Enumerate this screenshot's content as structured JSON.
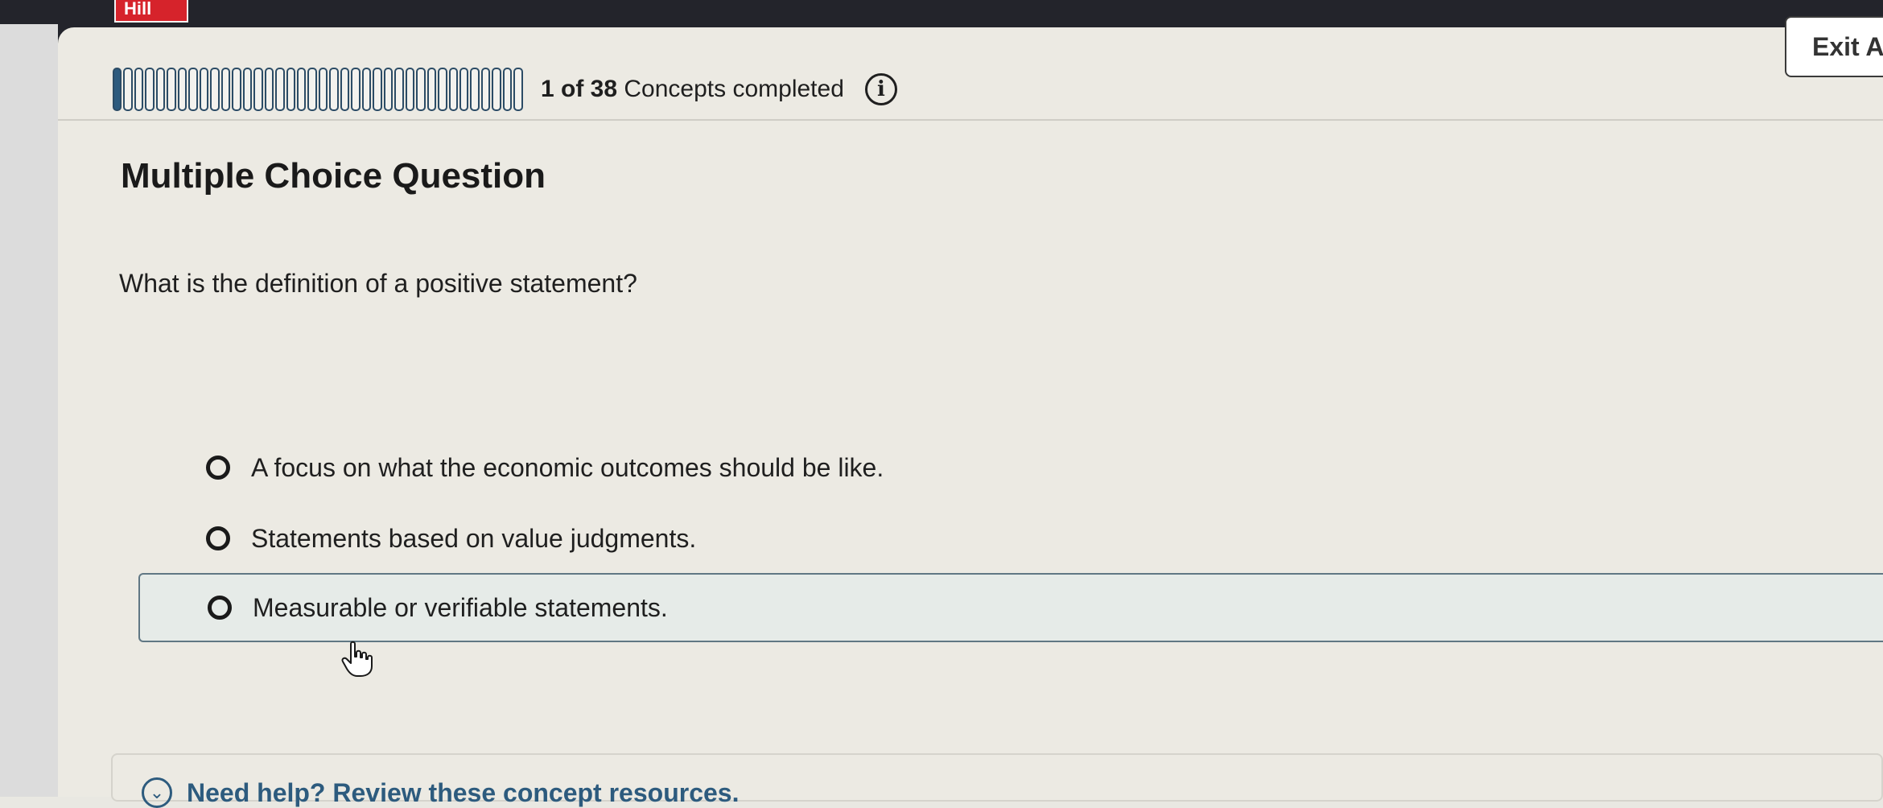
{
  "header": {
    "logo_text": "Hill",
    "exit_label": "Exit As"
  },
  "progress": {
    "completed": 1,
    "total": 38,
    "count_text": "1 of 38",
    "suffix_text": "Concepts completed",
    "info_icon_glyph": "i"
  },
  "question": {
    "type_label": "Multiple Choice Question",
    "prompt": "What is the definition of a positive statement?",
    "options": [
      {
        "label": "A focus on what the economic outcomes should be like."
      },
      {
        "label": "Statements based on value judgments."
      },
      {
        "label": "Measurable or verifiable statements."
      }
    ],
    "hovered_option_index": 2
  },
  "help": {
    "text": "Need help? Review these concept resources."
  },
  "colors": {
    "accent": "#2d5b7e",
    "topbar": "#23242b",
    "brand_red": "#d6232b",
    "hover_background": "#e6ebe8"
  }
}
